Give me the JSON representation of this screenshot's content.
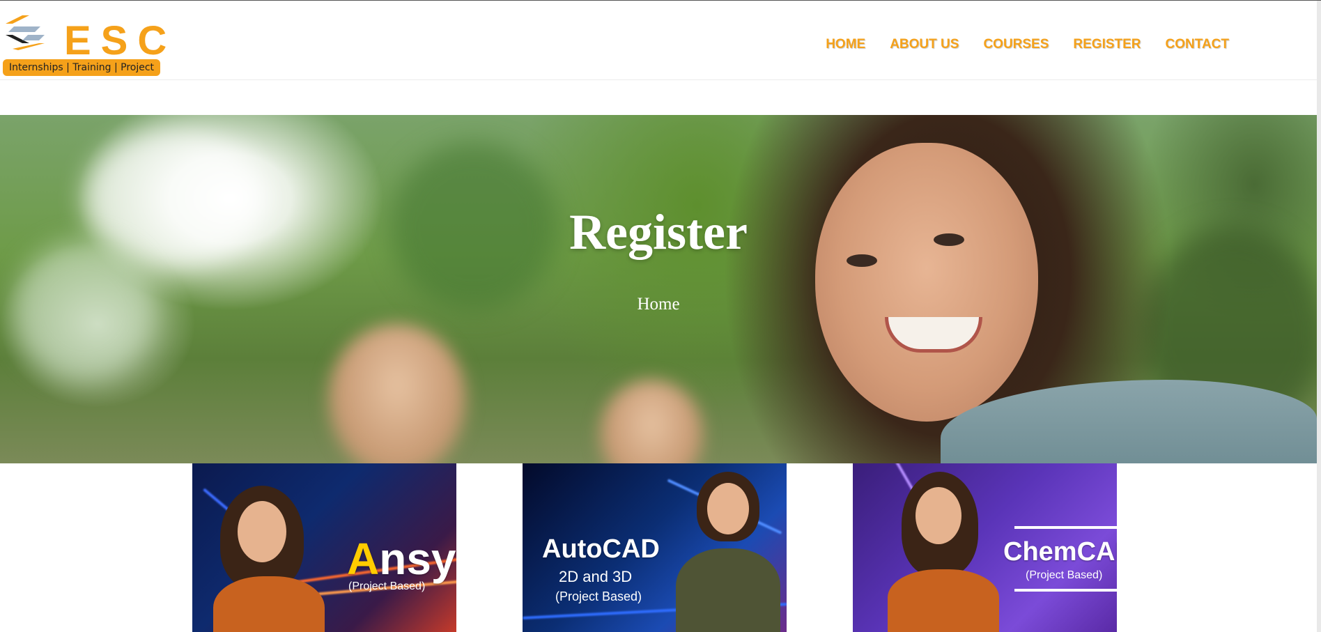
{
  "brand": {
    "name": "ESC",
    "tagline": "Internships | Training | Project",
    "colors": {
      "accent": "#f5a11a",
      "mark_blue": "#9fb3c8"
    }
  },
  "nav": {
    "items": [
      {
        "label": "HOME"
      },
      {
        "label": "ABOUT US"
      },
      {
        "label": "COURSES"
      },
      {
        "label": "REGISTER"
      },
      {
        "label": "CONTACT"
      }
    ]
  },
  "hero": {
    "title": "Register",
    "breadcrumb": "Home",
    "image": "smiling-woman-photo"
  },
  "courses": [
    {
      "title_first": "A",
      "title_rest": "nsys",
      "subtitle": "(Project Based)"
    },
    {
      "title": "AutoCAD",
      "line2": "2D and 3D",
      "subtitle": "(Project Based)"
    },
    {
      "title": "ChemCAD",
      "subtitle": "(Project Based)"
    }
  ]
}
